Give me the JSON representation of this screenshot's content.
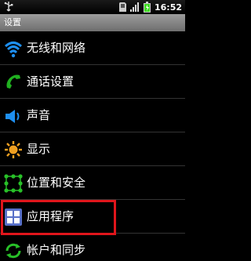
{
  "statusbar": {
    "time": "16:52",
    "icons": [
      "usb-icon",
      "sd-card-icon",
      "signal-icon",
      "battery-icon"
    ],
    "battery_color": "#3fdc23"
  },
  "title": "设置",
  "menu": [
    {
      "label": "无线和网络",
      "icon": "wifi-icon"
    },
    {
      "label": "通话设置",
      "icon": "phone-icon"
    },
    {
      "label": "声音",
      "icon": "speaker-icon"
    },
    {
      "label": "显示",
      "icon": "brightness-icon"
    },
    {
      "label": "位置和安全",
      "icon": "grid-lock-icon"
    },
    {
      "label": "应用程序",
      "icon": "apps-icon"
    },
    {
      "label": "帐户和同步",
      "icon": "sync-icon"
    }
  ],
  "colors": {
    "highlight": "#e0151b",
    "wifi": "#1e8ff0",
    "phone": "#20b020",
    "display": "#f0a020",
    "location": "#28c028"
  }
}
